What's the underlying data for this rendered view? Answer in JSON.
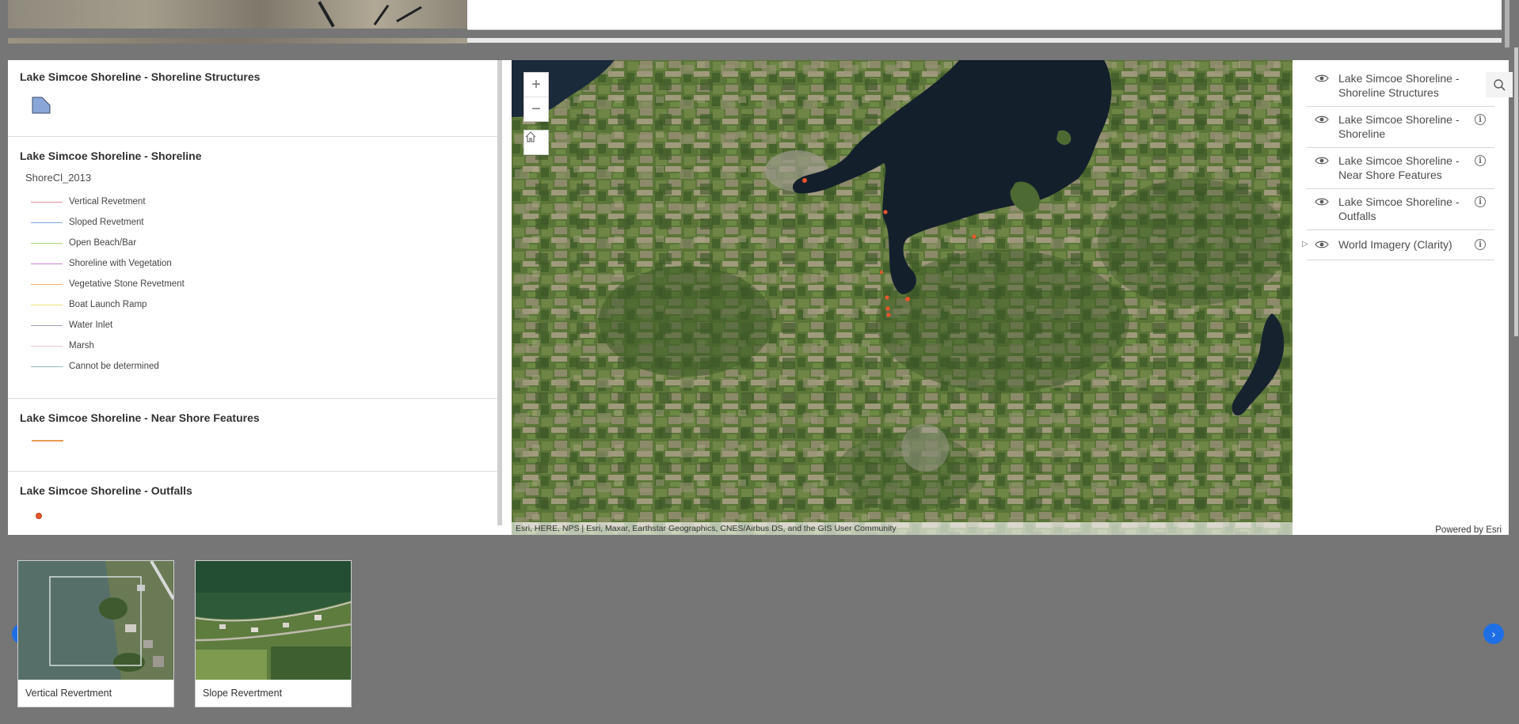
{
  "legend": {
    "sections": [
      {
        "title": "Lake Simcoe Shoreline - Shoreline Structures"
      },
      {
        "title": "Lake Simcoe Shoreline - Shoreline",
        "field": "ShoreCl_2013",
        "items": [
          {
            "label": "Vertical Revetment",
            "color": "#e88a9a"
          },
          {
            "label": "Sloped Revetment",
            "color": "#7ea6d8"
          },
          {
            "label": "Open Beach/Bar",
            "color": "#a8d87a"
          },
          {
            "label": "Shoreline with Vegetation",
            "color": "#c88ad0"
          },
          {
            "label": "Vegetative Stone Revetment",
            "color": "#f0b070"
          },
          {
            "label": "Boat Launch Ramp",
            "color": "#f0e070"
          },
          {
            "label": "Water Inlet",
            "color": "#9ea0b8"
          },
          {
            "label": "Marsh",
            "color": "#f0c8d0"
          },
          {
            "label": "Cannot be determined",
            "color": "#8fb8b8"
          }
        ]
      },
      {
        "title": "Lake Simcoe Shoreline - Near Shore Features"
      },
      {
        "title": "Lake Simcoe Shoreline - Outfalls"
      }
    ]
  },
  "map": {
    "zoom_in": "+",
    "zoom_out": "−",
    "attribution": "Esri, HERE, NPS | Esri, Maxar, Earthstar Geographics, CNES/Airbus DS, and the GIS User Community"
  },
  "layers": {
    "items": [
      {
        "label": "Lake Simcoe Shoreline - Shoreline Structures",
        "has_info": false,
        "expandable": false
      },
      {
        "label": "Lake Simcoe Shoreline - Shoreline",
        "has_info": true,
        "expandable": false
      },
      {
        "label": "Lake Simcoe Shoreline - Near Shore Features",
        "has_info": true,
        "expandable": false
      },
      {
        "label": "Lake Simcoe Shoreline - Outfalls",
        "has_info": true,
        "expandable": false
      },
      {
        "label": "World Imagery (Clarity)",
        "has_info": true,
        "expandable": true
      }
    ],
    "info_glyph": "i",
    "powered_by": "Powered by Esri"
  },
  "carousel": {
    "cards": [
      {
        "caption": "Vertical Revertment"
      },
      {
        "caption": "Slope Revertment"
      }
    ],
    "prev": "‹",
    "next": "›"
  }
}
